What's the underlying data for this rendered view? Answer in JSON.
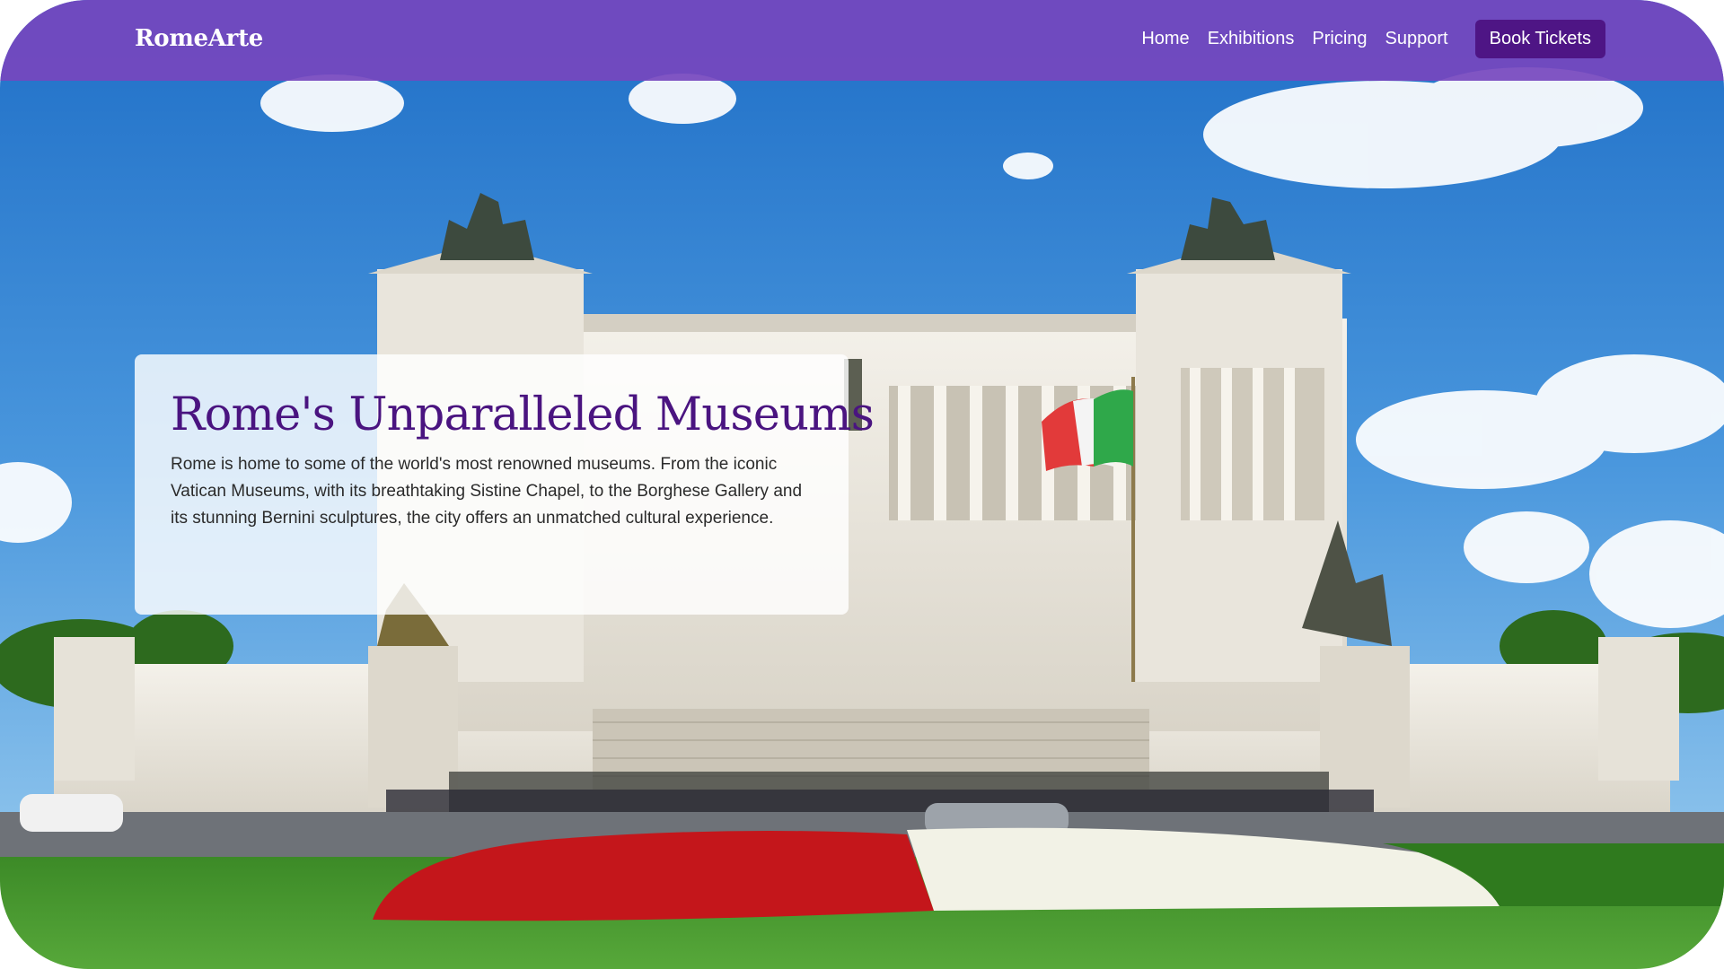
{
  "nav": {
    "logo": "RomeArte",
    "links": [
      "Home",
      "Exhibitions",
      "Pricing",
      "Support"
    ],
    "cta": "Book Tickets"
  },
  "hero": {
    "title": "Rome's Unparalleled Museums",
    "text": "Rome is home to some of the world's most renowned museums. From the iconic Vatican Museums, with its breathtaking Sistine Chapel, to the Borghese Gallery and its stunning Bernini sculptures, the city offers an unmatched cultural experience."
  },
  "colors": {
    "nav_bg": "#7646be",
    "cta_bg": "#4e1585",
    "title": "#4a1480",
    "sky": "#3a86d4",
    "monument": "#ece8df",
    "flowers_red": "#c4161b",
    "flowers_white": "#f2f2e6",
    "lawn": "#3f8f2a"
  }
}
